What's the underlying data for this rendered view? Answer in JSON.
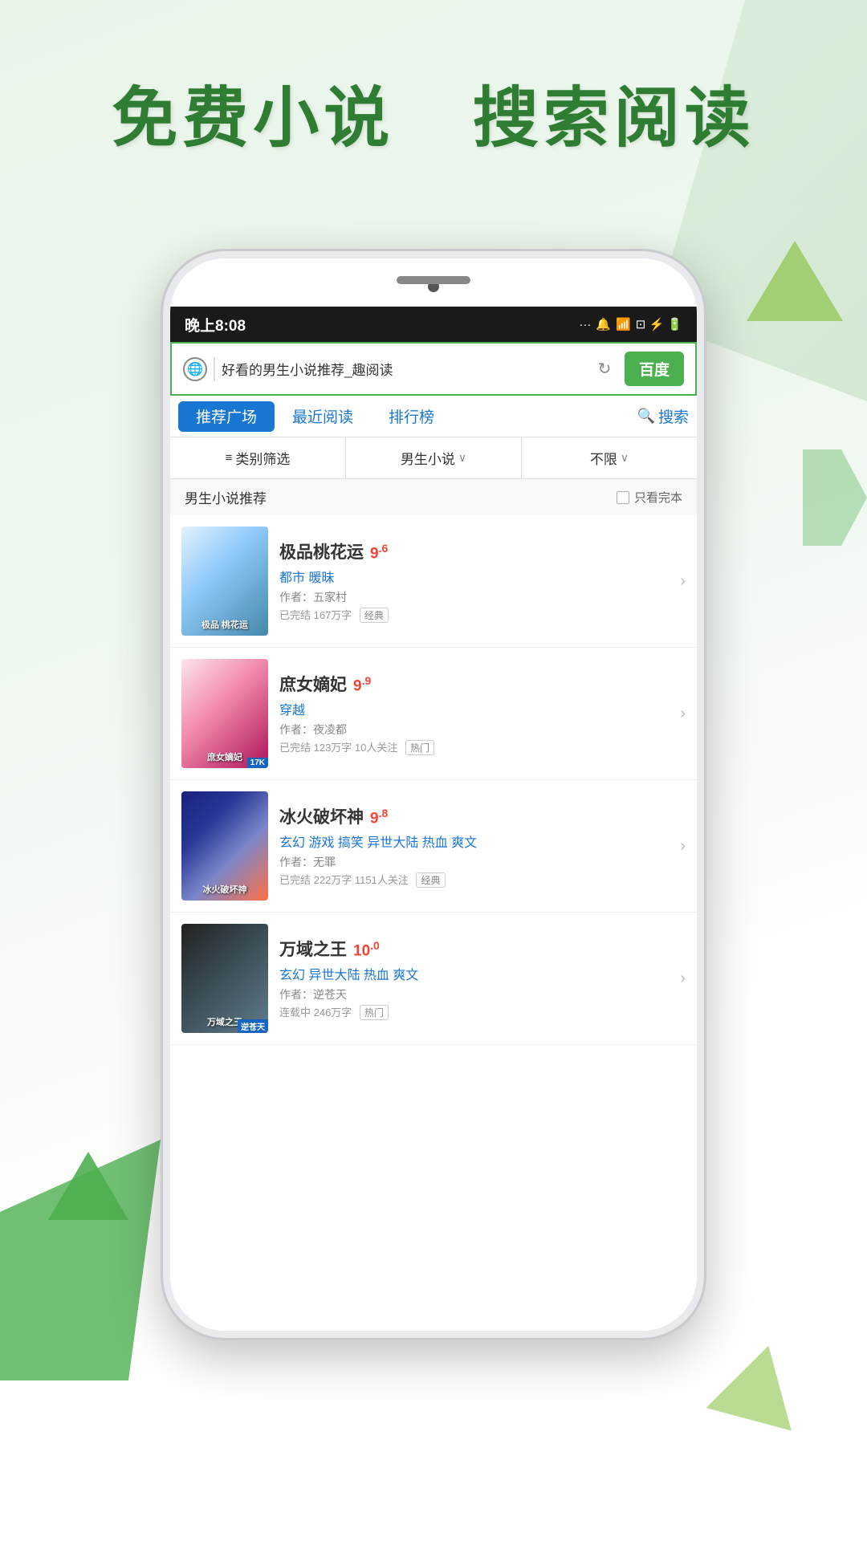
{
  "page": {
    "headline_part1": "免费小说",
    "headline_part2": "搜索阅读"
  },
  "status_bar": {
    "time": "晚上8:08",
    "dots": "···",
    "bell": "🔔",
    "wifi": "WiFi",
    "signal": "⊡",
    "battery": "🔋"
  },
  "search_bar": {
    "query": "好看的男生小说推荐_趣阅读",
    "baidu_label": "百度"
  },
  "nav_tabs": [
    {
      "id": "recommend",
      "label": "推荐广场",
      "active": true
    },
    {
      "id": "recent",
      "label": "最近阅读",
      "active": false
    },
    {
      "id": "ranking",
      "label": "排行榜",
      "active": false
    },
    {
      "id": "search",
      "label": "搜索",
      "active": false
    }
  ],
  "filter_bar": {
    "category_label": "类别筛选",
    "gender_label": "男生小说",
    "gender_suffix": "∨",
    "limit_label": "不限",
    "limit_suffix": "∨"
  },
  "section": {
    "title": "男生小说推荐",
    "only_complete_label": "只看完本"
  },
  "books": [
    {
      "id": 1,
      "title": "极品桃花运",
      "rating_int": "9",
      "rating_dec": "6",
      "genre": "都市 暖昧",
      "author": "作者：五家村",
      "meta": "已完结 167万字",
      "tag": "经典",
      "cover_class": "cover-1",
      "cover_text": "极品\n桃花运",
      "cover_label": ""
    },
    {
      "id": 2,
      "title": "庶女嫡妃",
      "rating_int": "9",
      "rating_dec": "9",
      "genre": "穿越",
      "author": "作者：夜凌都",
      "meta": "已完结 123万字 10人关注",
      "tag": "热门",
      "cover_class": "cover-2",
      "cover_text": "庶女嫡妃",
      "cover_label": "17K"
    },
    {
      "id": 3,
      "title": "冰火破坏神",
      "rating_int": "9",
      "rating_dec": "8",
      "genre": "玄幻 游戏 搞笑 异世大陆 热血 爽文",
      "author": "作者：无罪",
      "meta": "已完结 222万字 1151人关注",
      "tag": "经典",
      "cover_class": "cover-3",
      "cover_text": "冰火破坏神",
      "cover_label": ""
    },
    {
      "id": 4,
      "title": "万域之王",
      "rating_int": "10",
      "rating_dec": "0",
      "genre": "玄幻 异世大陆 热血 爽文",
      "author": "作者：逆苍天",
      "meta": "连载中 246万字",
      "tag": "热门",
      "cover_class": "cover-4",
      "cover_text": "万域之王",
      "cover_label": "逆苍天"
    }
  ]
}
